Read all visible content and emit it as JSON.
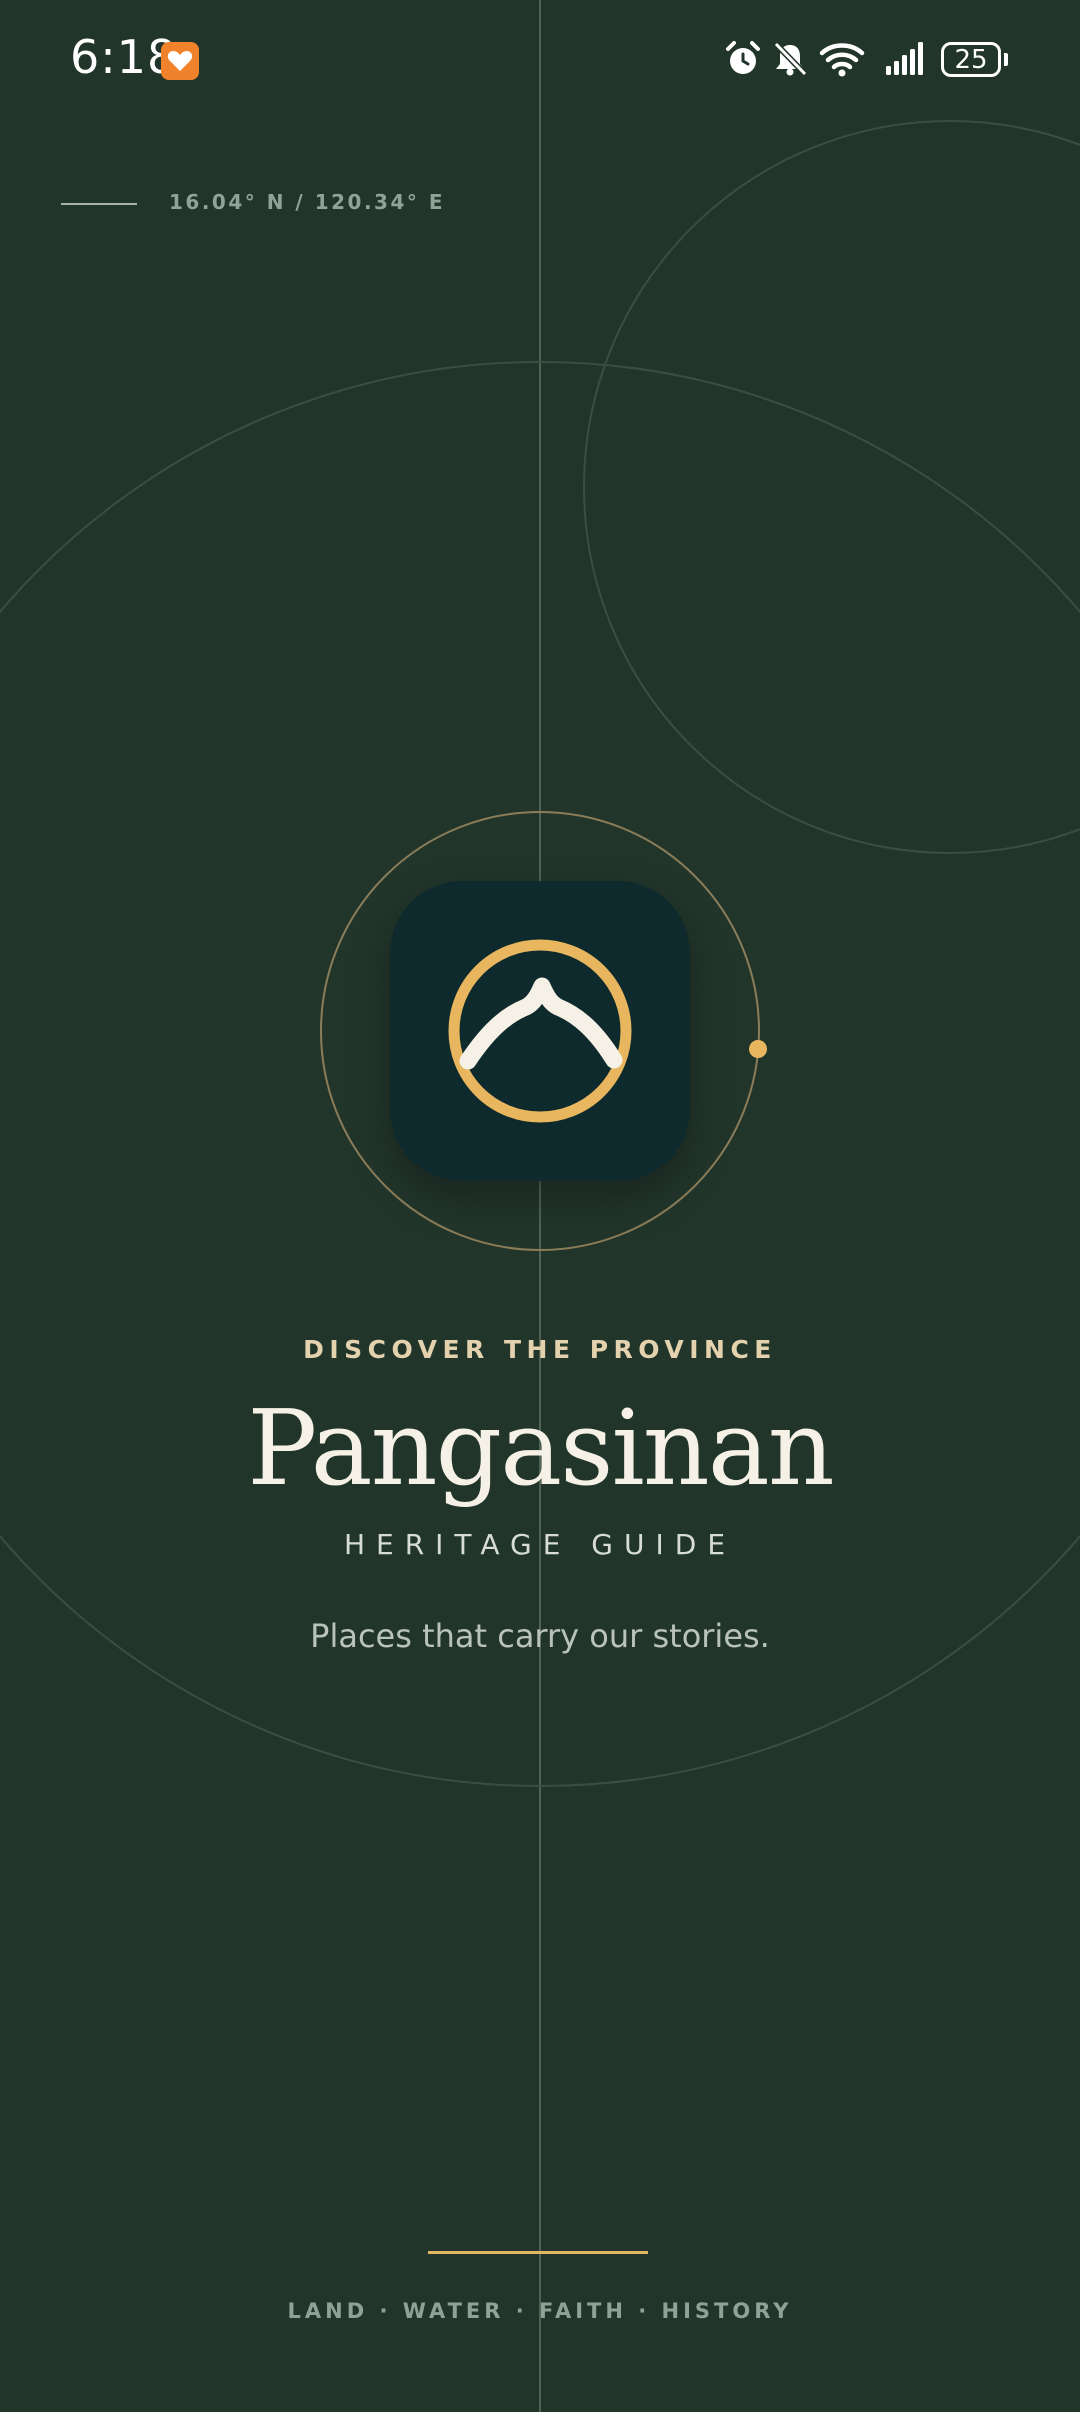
{
  "status_bar": {
    "time": "6:18",
    "battery_level": "25",
    "icons": [
      "app-badge-heart-icon",
      "alarm-icon",
      "bell-muted-icon",
      "wifi-icon",
      "signal-icon",
      "battery-icon"
    ]
  },
  "coordinates": "16.04° N / 120.34° E",
  "hero": {
    "eyebrow": "DISCOVER THE PROVINCE",
    "title": "Pangasinan",
    "subtitle": "HERITAGE GUIDE",
    "tagline": "Places that carry our stories."
  },
  "footer": {
    "pillars": "LAND · WATER · FAITH · HISTORY"
  },
  "colors": {
    "background": "#22352b",
    "tile": "#0e2a2c",
    "accent_gold": "#e8b65e",
    "cream": "#f6f1e6"
  }
}
